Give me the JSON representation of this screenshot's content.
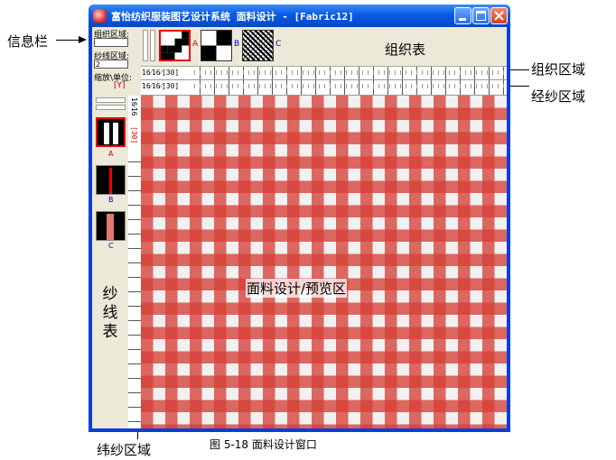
{
  "window": {
    "title": "富怡纺织服装图艺设计系统   面料设计 - [Fabric12]"
  },
  "annotations": {
    "info_bar": "信息栏",
    "weave_area": "组织区域",
    "warp_area": "经纱区域",
    "weft_area": "纬纱区域"
  },
  "info_panel": {
    "weave_area_label": "组织区域:",
    "weave_area_value": "",
    "yarn_area_label": "纱线区域:",
    "yarn_area_value": "2",
    "zoom_unit_label": "缩放\\单位:",
    "zoom_unit_value": "[Y]"
  },
  "weave_table": {
    "title": "组织表",
    "tiles": [
      {
        "label": "A"
      },
      {
        "label": "B"
      },
      {
        "label": "C"
      }
    ]
  },
  "weave_strip": {
    "prefix": "16⁄16⁄[30]"
  },
  "warp_strip": {
    "prefix": "16⁄16⁄[30]"
  },
  "weft_strip": {
    "text_top": "16⁄16",
    "text_bottom": "[30]"
  },
  "yarn_table": {
    "title": "纱线表",
    "tiles": [
      {
        "label": "A"
      },
      {
        "label": "B"
      },
      {
        "label": "C"
      }
    ]
  },
  "fabric": {
    "label": "面料设计/预览区"
  },
  "caption": "图 5-18    面料设计窗口",
  "colors": {
    "title_bar": "#0a5ae6",
    "fabric_red": "#d64038",
    "fabric_light": "#f0eeee",
    "window_face": "#ece9d8"
  }
}
